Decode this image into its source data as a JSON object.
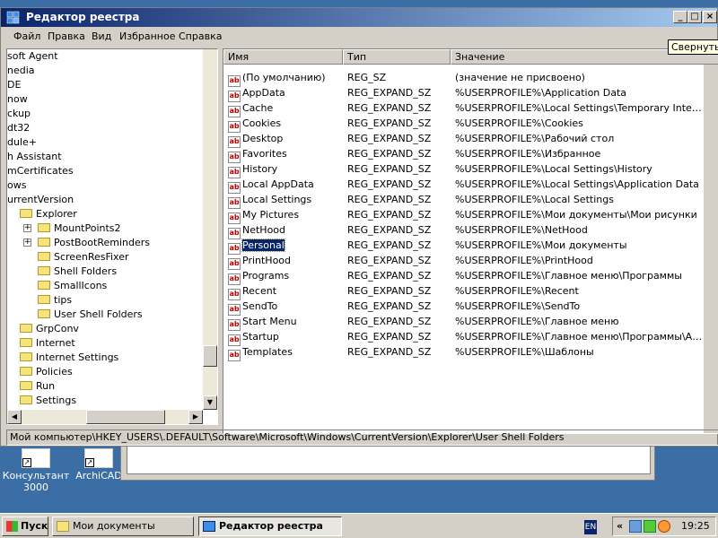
{
  "window": {
    "title": "Редактор реестра"
  },
  "menu": [
    "Файл",
    "Правка",
    "Вид",
    "Избранное",
    "Справка"
  ],
  "tooltip": "Свернуть",
  "tree": [
    {
      "label": "soft Agent",
      "indent": 0,
      "folder": false
    },
    {
      "label": "nedia",
      "indent": 0,
      "folder": false
    },
    {
      "label": "DE",
      "indent": 0,
      "folder": false
    },
    {
      "label": "now",
      "indent": 0,
      "folder": false
    },
    {
      "label": "ckup",
      "indent": 0,
      "folder": false
    },
    {
      "label": "dt32",
      "indent": 0,
      "folder": false
    },
    {
      "label": "dule+",
      "indent": 0,
      "folder": false
    },
    {
      "label": "h Assistant",
      "indent": 0,
      "folder": false
    },
    {
      "label": "mCertificates",
      "indent": 0,
      "folder": false
    },
    {
      "label": "ows",
      "indent": 0,
      "folder": false
    },
    {
      "label": "urrentVersion",
      "indent": 0,
      "folder": false
    },
    {
      "label": "Explorer",
      "indent": 1,
      "folder": true
    },
    {
      "label": "MountPoints2",
      "indent": 2,
      "folder": true,
      "expander": "+"
    },
    {
      "label": "PostBootReminders",
      "indent": 2,
      "folder": true,
      "expander": "+"
    },
    {
      "label": "ScreenResFixer",
      "indent": 2,
      "folder": true
    },
    {
      "label": "Shell Folders",
      "indent": 2,
      "folder": true
    },
    {
      "label": "SmallIcons",
      "indent": 2,
      "folder": true
    },
    {
      "label": "tips",
      "indent": 2,
      "folder": true
    },
    {
      "label": "User Shell Folders",
      "indent": 2,
      "folder": true,
      "open": true
    },
    {
      "label": "GrpConv",
      "indent": 1,
      "folder": true
    },
    {
      "label": "Internet",
      "indent": 1,
      "folder": true
    },
    {
      "label": "Internet Settings",
      "indent": 1,
      "folder": true
    },
    {
      "label": "Policies",
      "indent": 1,
      "folder": true
    },
    {
      "label": "Run",
      "indent": 1,
      "folder": true
    },
    {
      "label": "Settings",
      "indent": 1,
      "folder": true
    }
  ],
  "columns": [
    "Имя",
    "Тип",
    "Значение"
  ],
  "rows": [
    {
      "name": "(По умолчанию)",
      "type": "REG_SZ",
      "value": "(значение не присвоено)"
    },
    {
      "name": "AppData",
      "type": "REG_EXPAND_SZ",
      "value": "%USERPROFILE%\\Application Data"
    },
    {
      "name": "Cache",
      "type": "REG_EXPAND_SZ",
      "value": "%USERPROFILE%\\Local Settings\\Temporary Internet ..."
    },
    {
      "name": "Cookies",
      "type": "REG_EXPAND_SZ",
      "value": "%USERPROFILE%\\Cookies"
    },
    {
      "name": "Desktop",
      "type": "REG_EXPAND_SZ",
      "value": "%USERPROFILE%\\Рабочий стол"
    },
    {
      "name": "Favorites",
      "type": "REG_EXPAND_SZ",
      "value": "%USERPROFILE%\\Избранное"
    },
    {
      "name": "History",
      "type": "REG_EXPAND_SZ",
      "value": "%USERPROFILE%\\Local Settings\\History"
    },
    {
      "name": "Local AppData",
      "type": "REG_EXPAND_SZ",
      "value": "%USERPROFILE%\\Local Settings\\Application Data"
    },
    {
      "name": "Local Settings",
      "type": "REG_EXPAND_SZ",
      "value": "%USERPROFILE%\\Local Settings"
    },
    {
      "name": "My Pictures",
      "type": "REG_EXPAND_SZ",
      "value": "%USERPROFILE%\\Мои документы\\Мои рисунки"
    },
    {
      "name": "NetHood",
      "type": "REG_EXPAND_SZ",
      "value": "%USERPROFILE%\\NetHood"
    },
    {
      "name": "Personal",
      "type": "REG_EXPAND_SZ",
      "value": "%USERPROFILE%\\Мои документы",
      "selected": true
    },
    {
      "name": "PrintHood",
      "type": "REG_EXPAND_SZ",
      "value": "%USERPROFILE%\\PrintHood"
    },
    {
      "name": "Programs",
      "type": "REG_EXPAND_SZ",
      "value": "%USERPROFILE%\\Главное меню\\Программы"
    },
    {
      "name": "Recent",
      "type": "REG_EXPAND_SZ",
      "value": "%USERPROFILE%\\Recent"
    },
    {
      "name": "SendTo",
      "type": "REG_EXPAND_SZ",
      "value": "%USERPROFILE%\\SendTo"
    },
    {
      "name": "Start Menu",
      "type": "REG_EXPAND_SZ",
      "value": "%USERPROFILE%\\Главное меню"
    },
    {
      "name": "Startup",
      "type": "REG_EXPAND_SZ",
      "value": "%USERPROFILE%\\Главное меню\\Программы\\Автоз..."
    },
    {
      "name": "Templates",
      "type": "REG_EXPAND_SZ",
      "value": "%USERPROFILE%\\Шаблоны"
    }
  ],
  "statusbar": "Мой компьютер\\HKEY_USERS\\.DEFAULT\\Software\\Microsoft\\Windows\\CurrentVersion\\Explorer\\User Shell Folders",
  "desktop_icons": [
    {
      "label": "Консультант 3000"
    },
    {
      "label": "ArchiCAD"
    }
  ],
  "taskbar": {
    "start": "Пуск",
    "tasks": [
      {
        "label": "Мои документы",
        "active": false
      },
      {
        "label": "Редактор реестра",
        "active": true
      }
    ],
    "lang": "EN",
    "chevron": "«",
    "clock": "19:25"
  },
  "colors": {
    "desktop": "#3a6ea5",
    "title_from": "#0a246a",
    "title_to": "#a6caf0",
    "selection": "#0a246a"
  }
}
